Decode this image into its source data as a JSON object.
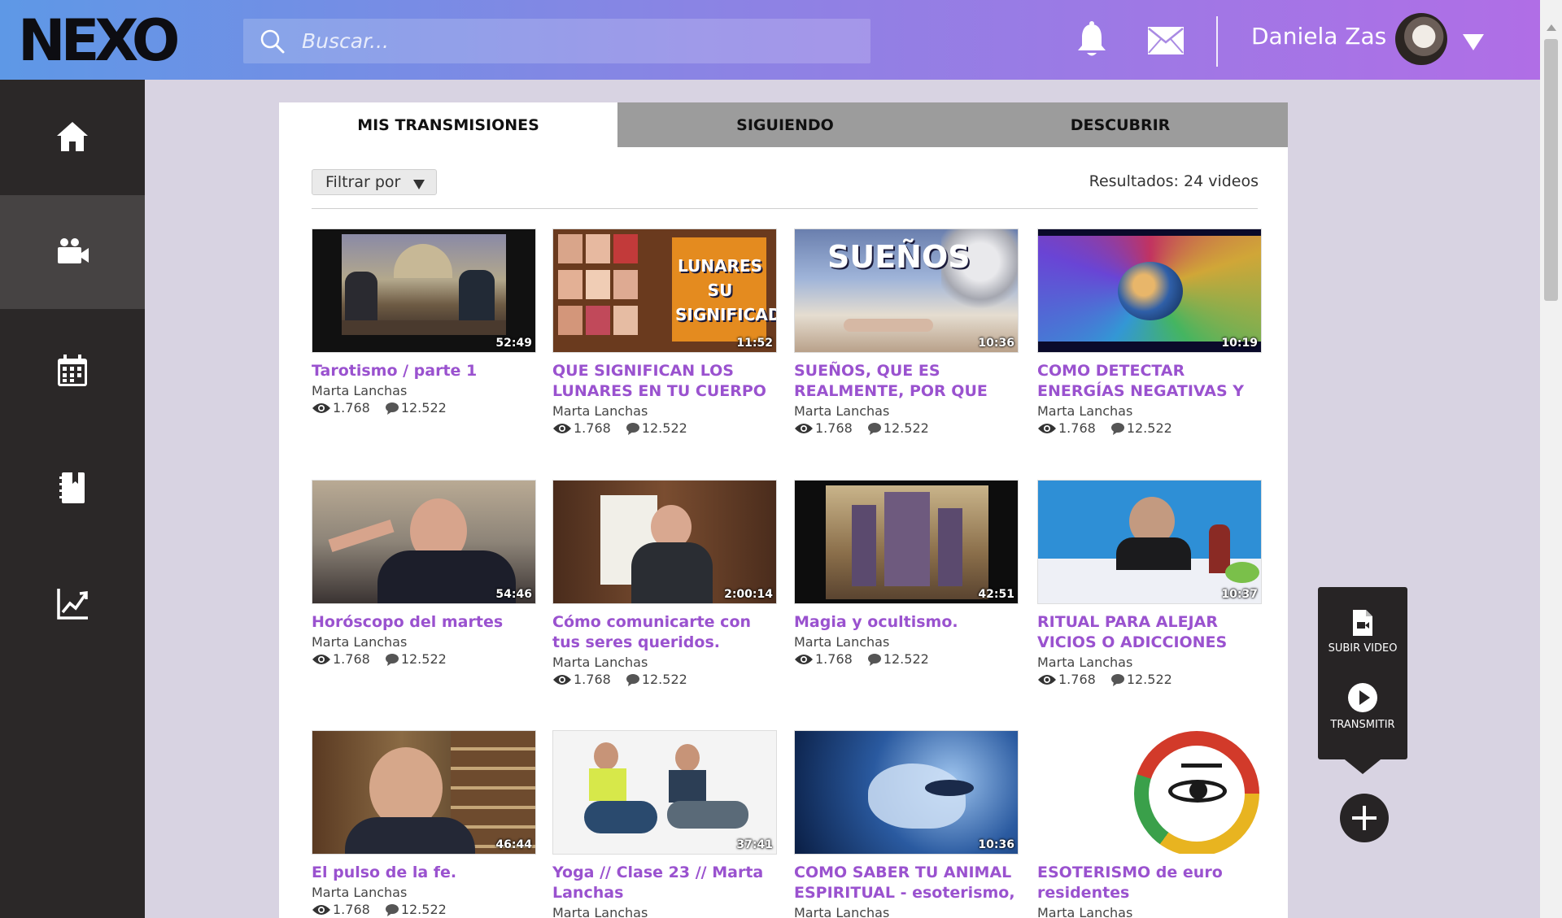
{
  "header": {
    "logo_text": "NEXO",
    "search_placeholder": "Buscar...",
    "username": "Daniela Zas"
  },
  "sidebar": {
    "items": [
      {
        "name": "home",
        "icon": "home-icon"
      },
      {
        "name": "transmisiones",
        "icon": "video-camera-icon",
        "active": true
      },
      {
        "name": "calendario",
        "icon": "calendar-icon"
      },
      {
        "name": "biblioteca",
        "icon": "book-icon"
      },
      {
        "name": "estadisticas",
        "icon": "chart-line-icon"
      }
    ]
  },
  "tabs": [
    {
      "label": "MIS TRANSMISIONES",
      "active": true
    },
    {
      "label": "SIGUIENDO",
      "active": false
    },
    {
      "label": "DESCUBRIR",
      "active": false
    }
  ],
  "toolbar": {
    "filter_label": "Filtrar por",
    "results_text": "Resultados: 24 videos"
  },
  "videos": [
    {
      "title": "Tarotismo / parte 1",
      "channel": "Marta Lanchas",
      "views": "1.768",
      "comments": "12.522",
      "duration": "52:49"
    },
    {
      "title": "QUE SIGNIFICAN LOS LUNARES EN TU CUERPO Y P...",
      "channel": "Marta Lanchas",
      "views": "1.768",
      "comments": "12.522",
      "duration": "11:52",
      "thumb_caption": "LUNARES SU SIGNIFICADO"
    },
    {
      "title": "SUEÑOS, QUE ES REALMENTE, POR QUE SOÑAMOS Y TU SU...",
      "channel": "Marta Lanchas",
      "views": "1.768",
      "comments": "12.522",
      "duration": "10:36",
      "thumb_caption": "SUEÑOS"
    },
    {
      "title": "COMO DETECTAR ENERGÍAS NEGATIVAS Y COMO ESPA...",
      "channel": "Marta Lanchas",
      "views": "1.768",
      "comments": "12.522",
      "duration": "10:19"
    },
    {
      "title": "Horóscopo del martes",
      "channel": "Marta Lanchas",
      "views": "1.768",
      "comments": "12.522",
      "duration": "54:46"
    },
    {
      "title": "Cómo comunicarte con tus seres queridos.",
      "channel": "Marta Lanchas",
      "views": "1.768",
      "comments": "12.522",
      "duration": "2:00:14"
    },
    {
      "title": "Magia y ocultismo.",
      "channel": "Marta Lanchas",
      "views": "1.768",
      "comments": "12.522",
      "duration": "42:51"
    },
    {
      "title": "RITUAL PARA ALEJAR VICIOS O ADICCIONES",
      "channel": "Marta Lanchas",
      "views": "1.768",
      "comments": "12.522",
      "duration": "10:37"
    },
    {
      "title": "El pulso de la fe.",
      "channel": "Marta Lanchas",
      "views": "1.768",
      "comments": "12.522",
      "duration": "46:44"
    },
    {
      "title": "Yoga // Clase 23 // Marta Lanchas",
      "channel": "Marta Lanchas",
      "views": "",
      "comments": "",
      "duration": "37:41"
    },
    {
      "title": "COMO SABER TU ANIMAL ESPIRITUAL - esoterismo, a...",
      "channel": "Marta Lanchas",
      "views": "",
      "comments": "",
      "duration": "10:36"
    },
    {
      "title": "ESOTERISMO de euro residentes",
      "channel": "Marta Lanchas",
      "views": "",
      "comments": "",
      "duration": ""
    }
  ],
  "float_menu": {
    "upload_label": "SUBIR VIDEO",
    "stream_label": "TRANSMITIR"
  },
  "colors": {
    "accent": "#9a52cf",
    "sidebar": "#2b2828",
    "header_start": "#5e98e6",
    "header_end": "#b06ee6"
  }
}
